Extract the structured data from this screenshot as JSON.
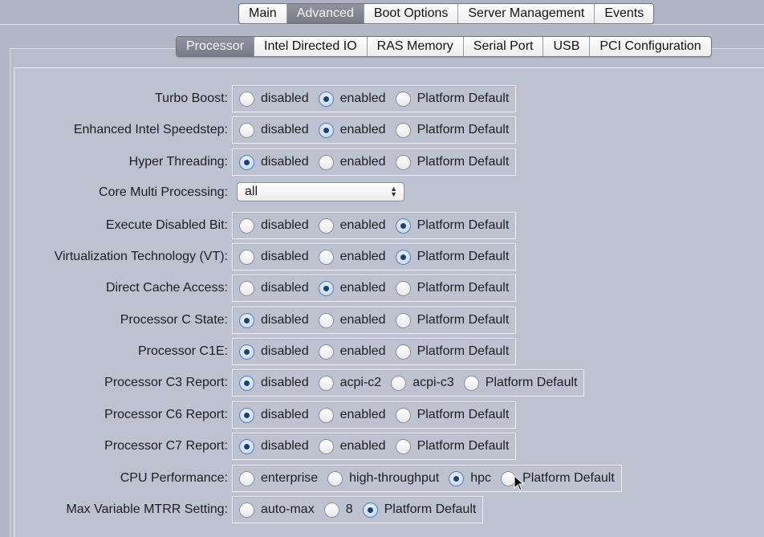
{
  "main_tabs": [
    {
      "label": "Main",
      "active": false
    },
    {
      "label": "Advanced",
      "active": true
    },
    {
      "label": "Boot Options",
      "active": false
    },
    {
      "label": "Server Management",
      "active": false
    },
    {
      "label": "Events",
      "active": false
    }
  ],
  "sub_tabs": [
    {
      "label": "Processor",
      "active": true
    },
    {
      "label": "Intel Directed IO",
      "active": false
    },
    {
      "label": "RAS Memory",
      "active": false
    },
    {
      "label": "Serial Port",
      "active": false
    },
    {
      "label": "USB",
      "active": false
    },
    {
      "label": "PCI Configuration",
      "active": false
    }
  ],
  "settings": [
    {
      "label": "Turbo Boost:",
      "options": [
        "disabled",
        "enabled",
        "Platform Default"
      ],
      "selected": "enabled"
    },
    {
      "label": "Enhanced Intel Speedstep:",
      "options": [
        "disabled",
        "enabled",
        "Platform Default"
      ],
      "selected": "enabled"
    },
    {
      "label": "Hyper Threading:",
      "options": [
        "disabled",
        "enabled",
        "Platform Default"
      ],
      "selected": "disabled"
    },
    {
      "label": "Core Multi Processing:",
      "type": "select",
      "value": "all"
    },
    {
      "label": "Execute Disabled Bit:",
      "options": [
        "disabled",
        "enabled",
        "Platform Default"
      ],
      "selected": "Platform Default"
    },
    {
      "label": "Virtualization Technology (VT):",
      "options": [
        "disabled",
        "enabled",
        "Platform Default"
      ],
      "selected": "Platform Default"
    },
    {
      "label": "Direct Cache Access:",
      "options": [
        "disabled",
        "enabled",
        "Platform Default"
      ],
      "selected": "enabled"
    },
    {
      "label": "Processor C State:",
      "options": [
        "disabled",
        "enabled",
        "Platform Default"
      ],
      "selected": "disabled"
    },
    {
      "label": "Processor C1E:",
      "options": [
        "disabled",
        "enabled",
        "Platform Default"
      ],
      "selected": "disabled"
    },
    {
      "label": "Processor C3 Report:",
      "options": [
        "disabled",
        "acpi-c2",
        "acpi-c3",
        "Platform Default"
      ],
      "selected": "disabled"
    },
    {
      "label": "Processor C6 Report:",
      "options": [
        "disabled",
        "enabled",
        "Platform Default"
      ],
      "selected": "disabled"
    },
    {
      "label": "Processor C7 Report:",
      "options": [
        "disabled",
        "enabled",
        "Platform Default"
      ],
      "selected": "disabled"
    },
    {
      "label": "CPU Performance:",
      "options": [
        "enterprise",
        "high-throughput",
        "hpc",
        "Platform Default"
      ],
      "selected": "hpc"
    },
    {
      "label": "Max Variable MTRR Setting:",
      "options": [
        "auto-max",
        "8",
        "Platform Default"
      ],
      "selected": "Platform Default"
    }
  ]
}
